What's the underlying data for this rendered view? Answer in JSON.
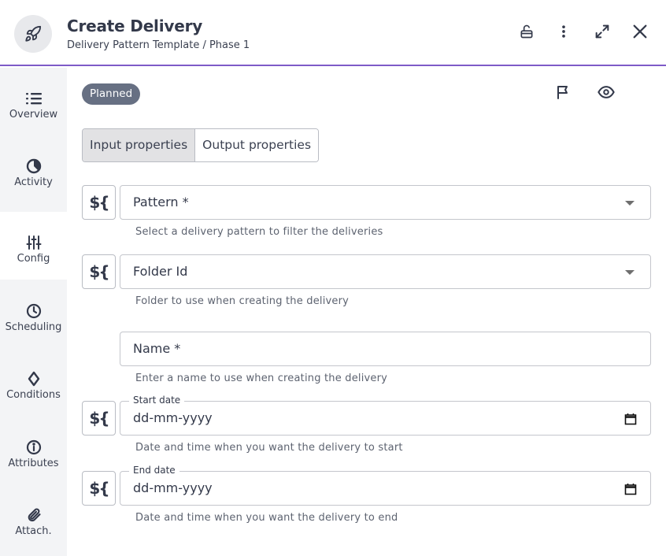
{
  "header": {
    "app_icon": "rocket-icon",
    "title": "Create Delivery",
    "subtitle": "Delivery Pattern Template / Phase 1",
    "actions": [
      {
        "name": "unlock",
        "icon": "unlock-icon"
      },
      {
        "name": "more",
        "icon": "more-vertical-icon"
      },
      {
        "name": "expand",
        "icon": "expand-icon"
      },
      {
        "name": "close",
        "icon": "close-icon"
      }
    ],
    "accent_color": "#7e5bc8"
  },
  "sidebar": {
    "items": [
      {
        "label": "Overview",
        "icon": "list-icon",
        "active": false
      },
      {
        "label": "Activity",
        "icon": "activity-icon",
        "active": false
      },
      {
        "label": "Config",
        "icon": "sliders-icon",
        "active": true
      },
      {
        "label": "Scheduling",
        "icon": "clock-icon",
        "active": false
      },
      {
        "label": "Conditions",
        "icon": "diamond-icon",
        "active": false
      },
      {
        "label": "Attributes",
        "icon": "info-icon",
        "active": false
      },
      {
        "label": "Attach.",
        "icon": "paperclip-icon",
        "active": false
      }
    ]
  },
  "main": {
    "status_badge": "Planned",
    "status_color": "#677083",
    "top_icons": [
      "flag-icon",
      "eye-icon"
    ],
    "tabs": [
      {
        "label": "Input properties",
        "active": true
      },
      {
        "label": "Output properties",
        "active": false
      }
    ],
    "expression_button_label": "${",
    "fields": [
      {
        "label": "Pattern *",
        "type": "select",
        "helper": "Select a delivery pattern to filter the deliveries",
        "has_expression": true
      },
      {
        "label": "Folder Id",
        "type": "select",
        "helper": "Folder to use when creating the delivery",
        "has_expression": true
      },
      {
        "label": "Name *",
        "type": "text",
        "helper": "Enter a name to use when creating the delivery",
        "has_expression": false
      },
      {
        "label": "Start date",
        "type": "date",
        "placeholder": "dd-mm-yyyy",
        "helper": "Date and time when you want the delivery to start",
        "has_expression": true
      },
      {
        "label": "End date",
        "type": "date",
        "placeholder": "dd-mm-yyyy",
        "helper": "Date and time when you want the delivery to end",
        "has_expression": true
      }
    ]
  }
}
